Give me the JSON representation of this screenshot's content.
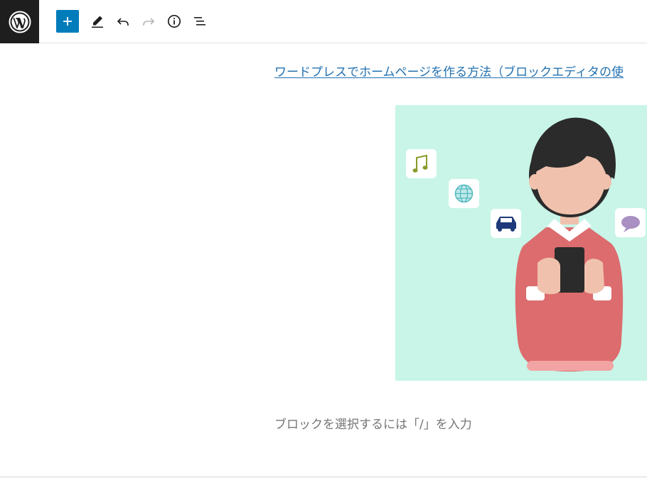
{
  "toolbar": {
    "logo_icon": "wordpress-icon",
    "buttons": [
      {
        "name": "add-block-button",
        "icon": "plus-icon",
        "color": "#007cba"
      },
      {
        "name": "tools-button",
        "icon": "pencil-icon"
      },
      {
        "name": "undo-button",
        "icon": "undo-icon"
      },
      {
        "name": "redo-button",
        "icon": "redo-icon",
        "disabled": true
      },
      {
        "name": "details-button",
        "icon": "info-icon"
      },
      {
        "name": "list-view-button",
        "icon": "list-view-icon"
      }
    ]
  },
  "content": {
    "link_text": "ワードプレスでホームページを作る方法（ブロックエディタの使",
    "image_icons": [
      "music-note-icon",
      "globe-icon",
      "car-icon",
      "speech-bubble-icon"
    ],
    "placeholder": "ブロックを選択するには「/」を入力"
  },
  "colors": {
    "accent": "#007cba",
    "link": "#2271b1",
    "image_bg": "#c8f5e7"
  }
}
